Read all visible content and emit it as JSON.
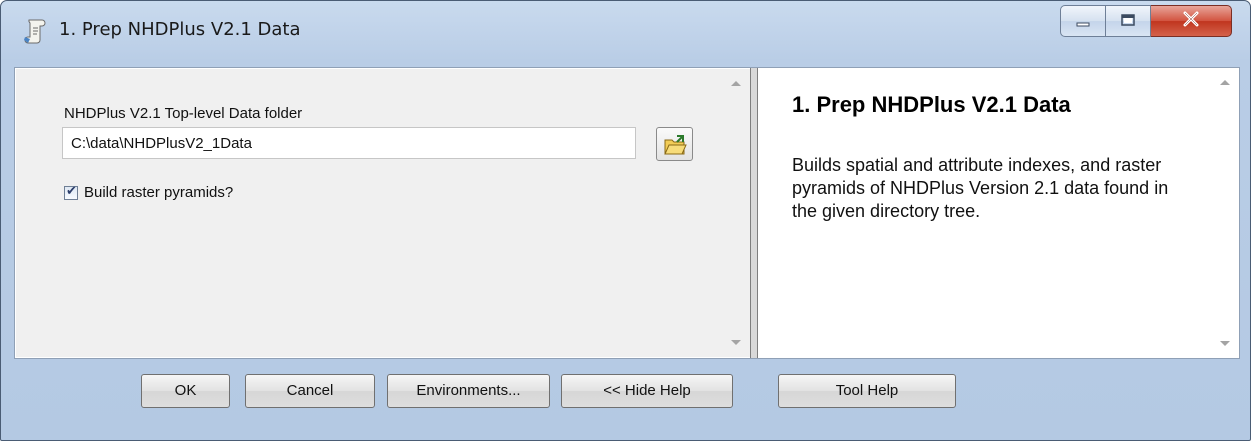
{
  "window": {
    "title": "1. Prep NHDPlus V2.1 Data"
  },
  "form": {
    "folder_label": "NHDPlus V2.1 Top-level Data folder",
    "folder_value": "C:\\data\\NHDPlusV2_1Data",
    "pyramids_label": "Build raster pyramids?",
    "pyramids_checked": true
  },
  "help": {
    "title": "1. Prep NHDPlus V2.1 Data",
    "body": "Builds spatial and attribute indexes, and raster pyramids of NHDPlus Version 2.1 data found in the given directory tree."
  },
  "buttons": {
    "ok": "OK",
    "cancel": "Cancel",
    "environments": "Environments...",
    "hide_help": "<< Hide Help",
    "tool_help": "Tool Help"
  },
  "icons": {
    "title": "script-tool-icon",
    "browse": "open-folder-icon",
    "minimize": "minimize-icon",
    "maximize": "maximize-icon",
    "close": "close-icon"
  }
}
